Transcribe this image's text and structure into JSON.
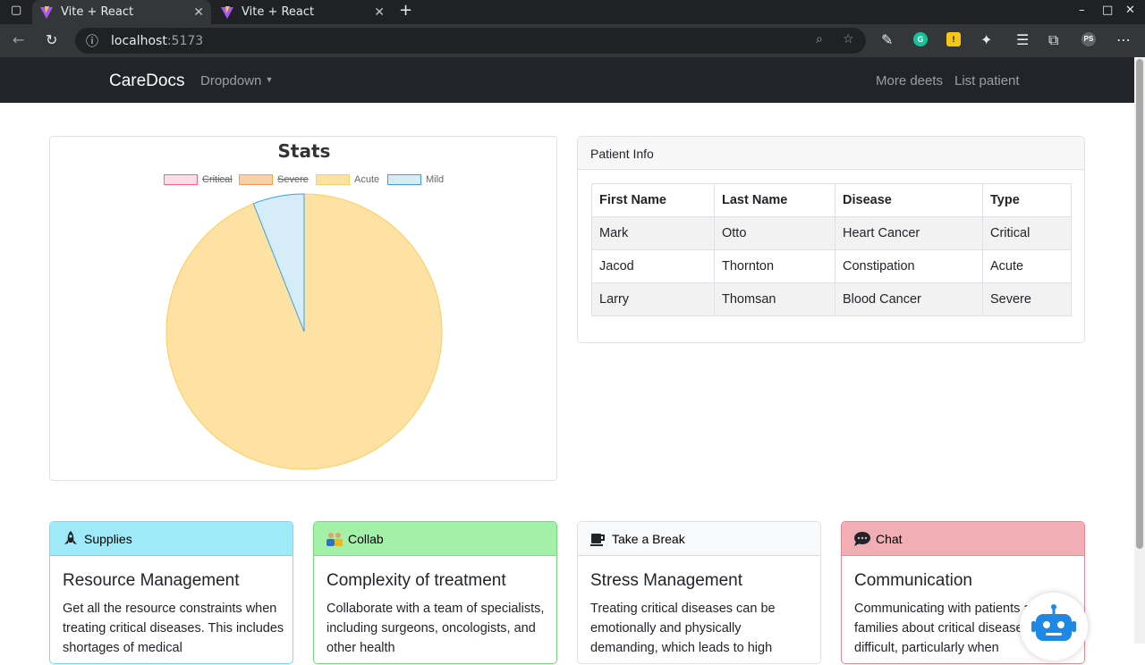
{
  "browser": {
    "tabs": [
      {
        "title": "Vite + React",
        "active": true
      },
      {
        "title": "Vite + React",
        "active": false
      }
    ],
    "url_host": "localhost",
    "url_port": ":5173",
    "profile_initials": "PS"
  },
  "navbar": {
    "brand": "CareDocs",
    "dropdown_label": "Dropdown",
    "links": [
      "More deets",
      "List patient"
    ]
  },
  "chart_data": {
    "type": "pie",
    "title": "Stats",
    "legend_position": "top",
    "series": [
      {
        "name": "Critical",
        "value": 0,
        "hidden": true,
        "fill": "#fddde6",
        "stroke": "#ff6384"
      },
      {
        "name": "Severe",
        "value": 0,
        "hidden": true,
        "fill": "#fbd0a8",
        "stroke": "#ff9f40"
      },
      {
        "name": "Acute",
        "value": 94,
        "hidden": false,
        "fill": "#fde2a3",
        "stroke": "#ffcd56"
      },
      {
        "name": "Mild",
        "value": 6,
        "hidden": false,
        "fill": "#d6ecf9",
        "stroke": "#36a2eb"
      }
    ]
  },
  "patient_info": {
    "header": "Patient Info",
    "columns": [
      "First Name",
      "Last Name",
      "Disease",
      "Type"
    ],
    "rows": [
      [
        "Mark",
        "Otto",
        "Heart Cancer",
        "Critical"
      ],
      [
        "Jacod",
        "Thornton",
        "Constipation",
        "Acute"
      ],
      [
        "Larry",
        "Thomsan",
        "Blood Cancer",
        "Severe"
      ]
    ]
  },
  "feature_cards": [
    {
      "header": "Supplies",
      "icon": "rocket-icon",
      "title": "Resource Management",
      "text": "Get all the resource constraints when treating critical diseases. This includes shortages of medical",
      "bg": "#9eeaf9",
      "border": "#6edff6"
    },
    {
      "header": "Collab",
      "icon": "people-icon",
      "title": "Complexity of treatment",
      "text": "Collaborate with a team of specialists, including surgeons, oncologists, and other health",
      "bg": "#a3f0a9",
      "border": "#75d67c"
    },
    {
      "header": "Take a Break",
      "icon": "coffee-icon",
      "title": "Stress Management",
      "text": "Treating critical diseases can be emotionally and physically demanding, which leads to high",
      "bg": "#f8f9fa",
      "border": "#dee2e6"
    },
    {
      "header": "Chat",
      "icon": "chat-bubble-icon",
      "title": "Communication",
      "text": "Communicating with patients and their families about critical diseases can be difficult, particularly when",
      "bg": "#f1aeb5",
      "border": "#ea868f"
    }
  ]
}
